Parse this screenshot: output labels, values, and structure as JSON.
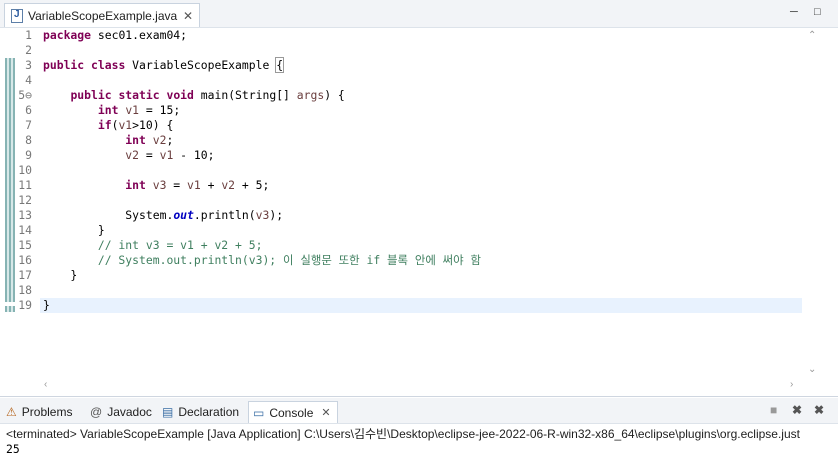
{
  "editor": {
    "tab_title": "VariableScopeExample.java",
    "tab_close": "✕",
    "minimize": "─",
    "maximize": "□",
    "lines": [
      {
        "num": "1",
        "parts": [
          {
            "t": "package",
            "c": "kw"
          },
          {
            "t": " sec01.exam04;",
            "c": ""
          }
        ]
      },
      {
        "num": "2",
        "parts": []
      },
      {
        "num": "3",
        "parts": [
          {
            "t": "public",
            "c": "kw"
          },
          {
            "t": " ",
            "c": ""
          },
          {
            "t": "class",
            "c": "kw"
          },
          {
            "t": " VariableScopeExample ",
            "c": ""
          },
          {
            "t": "{",
            "c": "brace"
          }
        ]
      },
      {
        "num": "4",
        "parts": []
      },
      {
        "num": "5⊖",
        "parts": [
          {
            "t": "    ",
            "c": ""
          },
          {
            "t": "public",
            "c": "kw"
          },
          {
            "t": " ",
            "c": ""
          },
          {
            "t": "static",
            "c": "kw"
          },
          {
            "t": " ",
            "c": ""
          },
          {
            "t": "void",
            "c": "kw"
          },
          {
            "t": " main(String[] ",
            "c": ""
          },
          {
            "t": "args",
            "c": "var"
          },
          {
            "t": ") {",
            "c": ""
          }
        ]
      },
      {
        "num": "6",
        "parts": [
          {
            "t": "        ",
            "c": ""
          },
          {
            "t": "int",
            "c": "kw"
          },
          {
            "t": " ",
            "c": ""
          },
          {
            "t": "v1",
            "c": "var"
          },
          {
            "t": " = 15;",
            "c": ""
          }
        ]
      },
      {
        "num": "7",
        "parts": [
          {
            "t": "        ",
            "c": ""
          },
          {
            "t": "if",
            "c": "kw"
          },
          {
            "t": "(",
            "c": ""
          },
          {
            "t": "v1",
            "c": "var"
          },
          {
            "t": ">10) {",
            "c": ""
          }
        ]
      },
      {
        "num": "8",
        "parts": [
          {
            "t": "            ",
            "c": ""
          },
          {
            "t": "int",
            "c": "kw"
          },
          {
            "t": " ",
            "c": ""
          },
          {
            "t": "v2",
            "c": "var"
          },
          {
            "t": ";",
            "c": ""
          }
        ]
      },
      {
        "num": "9",
        "parts": [
          {
            "t": "            ",
            "c": ""
          },
          {
            "t": "v2",
            "c": "var"
          },
          {
            "t": " = ",
            "c": ""
          },
          {
            "t": "v1",
            "c": "var"
          },
          {
            "t": " - 10;",
            "c": ""
          }
        ]
      },
      {
        "num": "10",
        "parts": []
      },
      {
        "num": "11",
        "parts": [
          {
            "t": "            ",
            "c": ""
          },
          {
            "t": "int",
            "c": "kw"
          },
          {
            "t": " ",
            "c": ""
          },
          {
            "t": "v3",
            "c": "var"
          },
          {
            "t": " = ",
            "c": ""
          },
          {
            "t": "v1",
            "c": "var"
          },
          {
            "t": " + ",
            "c": ""
          },
          {
            "t": "v2",
            "c": "var"
          },
          {
            "t": " + 5;",
            "c": ""
          }
        ]
      },
      {
        "num": "12",
        "parts": []
      },
      {
        "num": "13",
        "parts": [
          {
            "t": "            System.",
            "c": ""
          },
          {
            "t": "out",
            "c": "static"
          },
          {
            "t": ".println(",
            "c": ""
          },
          {
            "t": "v3",
            "c": "var"
          },
          {
            "t": ");",
            "c": ""
          }
        ]
      },
      {
        "num": "14",
        "parts": [
          {
            "t": "        }",
            "c": ""
          }
        ]
      },
      {
        "num": "15",
        "parts": [
          {
            "t": "        // int v3 = v1 + v2 + 5;",
            "c": "cm"
          }
        ]
      },
      {
        "num": "16",
        "parts": [
          {
            "t": "        // System.out.println(v3); 이 실행문 또한 if 블록 안에 써야 함",
            "c": "cm"
          }
        ]
      },
      {
        "num": "17",
        "parts": [
          {
            "t": "    }",
            "c": ""
          }
        ]
      },
      {
        "num": "18",
        "parts": []
      },
      {
        "num": "19",
        "parts": [
          {
            "t": "}",
            "c": ""
          }
        ]
      }
    ]
  },
  "panel": {
    "tabs": [
      {
        "label": "Problems",
        "icon": "problems-icon"
      },
      {
        "label": "Javadoc",
        "icon": "javadoc-icon"
      },
      {
        "label": "Declaration",
        "icon": "declaration-icon"
      },
      {
        "label": "Console",
        "icon": "console-icon",
        "active": true
      }
    ],
    "console_close": "✕",
    "status": "<terminated> VariableScopeExample [Java Application] C:\\Users\\김수빈\\Desktop\\eclipse-jee-2022-06-R-win32-x86_64\\eclipse\\plugins\\org.eclipse.just",
    "output": "25"
  }
}
